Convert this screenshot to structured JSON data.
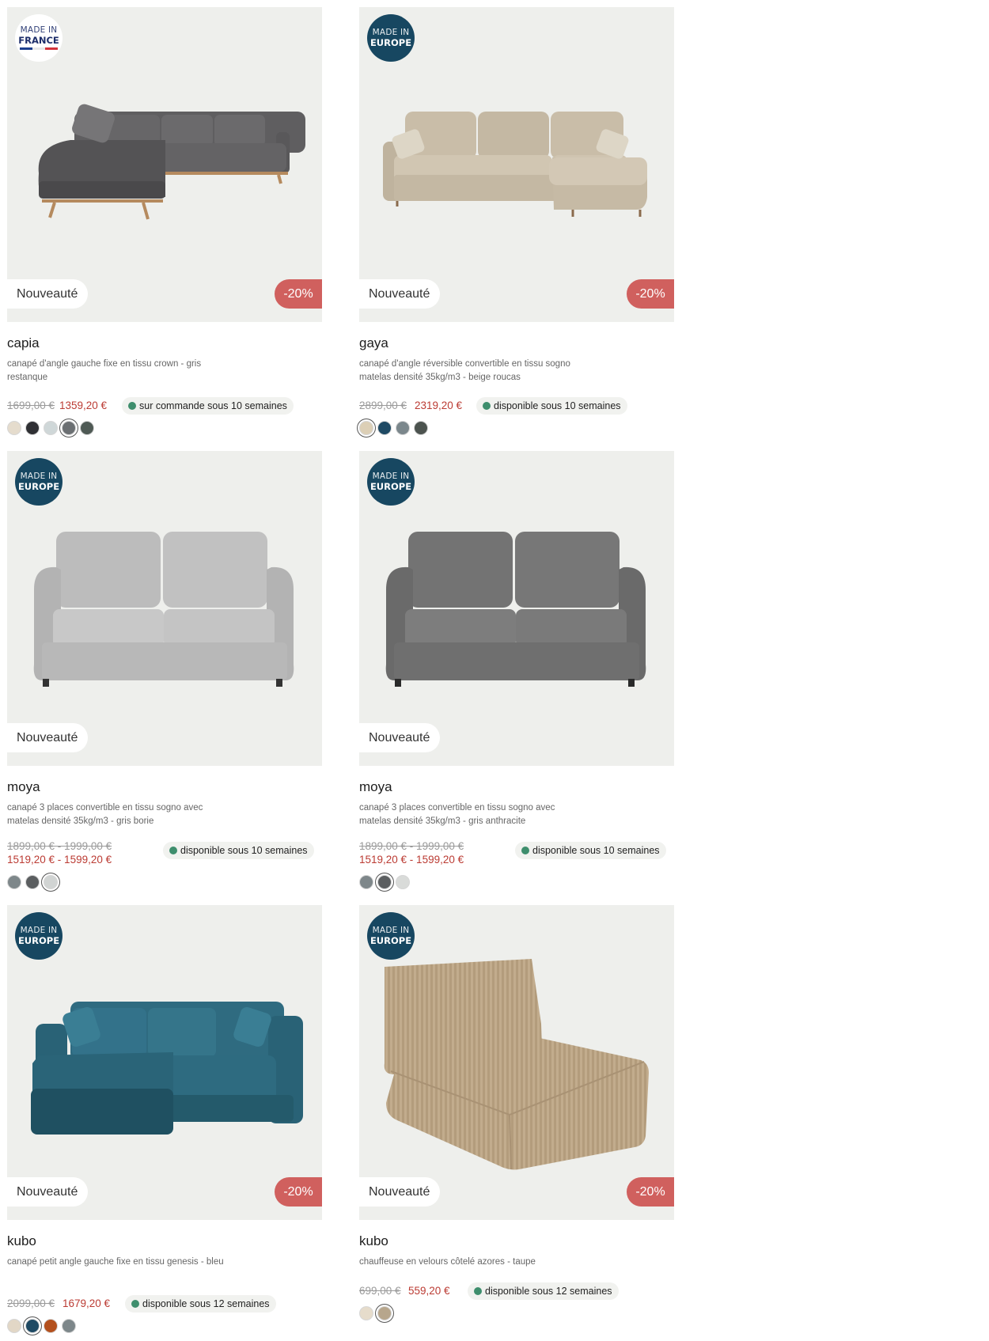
{
  "products": [
    {
      "badge_line1": "MADE IN",
      "badge_line2": "FRANCE",
      "new_label": "Nouveauté",
      "discount": "-20%",
      "name": "capia",
      "description": "canapé d'angle gauche fixe en tissu crown - gris restanque",
      "old_price": "1699,00 €",
      "new_price": "1359,20 €",
      "availability": "sur commande sous 10 semaines",
      "swatches": [
        "#e5dccd",
        "#2f3034",
        "#cfd7d8",
        "#6b6f72",
        "#4f5a55"
      ],
      "selected_swatch": 3
    },
    {
      "badge_line1": "MADE IN",
      "badge_line2": "EUROPE",
      "new_label": "Nouveauté",
      "discount": "-20%",
      "name": "gaya",
      "description": "canapé d'angle réversible convertible en tissu sogno matelas densité 35kg/m3 - beige roucas",
      "old_price": "2899,00 €",
      "new_price": "2319,20 €",
      "availability": "disponible sous 10 semaines",
      "swatches": [
        "#dccfb6",
        "#1f4a64",
        "#7b878c",
        "#4c534f"
      ],
      "selected_swatch": 0
    },
    {
      "badge_line1": "MADE IN",
      "badge_line2": "EUROPE",
      "new_label": "Nouveauté",
      "name": "moya",
      "description": "canapé 3 places convertible en tissu sogno avec matelas densité 35kg/m3 - gris borie",
      "old_price": "1899,00 € - 1999,00 €",
      "new_price": "1519,20 € - 1599,20 €",
      "availability": "disponible sous 10 semaines",
      "swatches": [
        "#7e878a",
        "#5b5e60",
        "#d1d4d3"
      ],
      "selected_swatch": 2
    },
    {
      "badge_line1": "MADE IN",
      "badge_line2": "EUROPE",
      "new_label": "Nouveauté",
      "name": "moya",
      "description": "canapé 3 places convertible en tissu sogno avec matelas densité 35kg/m3 - gris anthracite",
      "old_price": "1899,00 € - 1999,00 €",
      "new_price": "1519,20 € - 1599,20 €",
      "availability": "disponible sous 10 semaines",
      "swatches": [
        "#7e878a",
        "#5b5e60",
        "#d9dbd9"
      ],
      "selected_swatch": 1
    },
    {
      "badge_line1": "MADE IN",
      "badge_line2": "EUROPE",
      "new_label": "Nouveauté",
      "discount": "-20%",
      "name": "kubo",
      "description": "canapé petit angle gauche fixe en tissu genesis - bleu",
      "old_price": "2099,00 €",
      "new_price": "1679,20 €",
      "availability": "disponible sous 12 semaines",
      "swatches": [
        "#e2d7c6",
        "#1f4a64",
        "#b3501d",
        "#7d878a"
      ],
      "selected_swatch": 1
    },
    {
      "badge_line1": "MADE IN",
      "badge_line2": "EUROPE",
      "new_label": "Nouveauté",
      "discount": "-20%",
      "name": "kubo",
      "description": "chauffeuse en velours côtelé azores - taupe",
      "old_price": "699,00 €",
      "new_price": "559,20 €",
      "availability": "disponible sous 12 semaines",
      "swatches": [
        "#e6dccb",
        "#b7a68c"
      ],
      "selected_swatch": 1
    }
  ]
}
